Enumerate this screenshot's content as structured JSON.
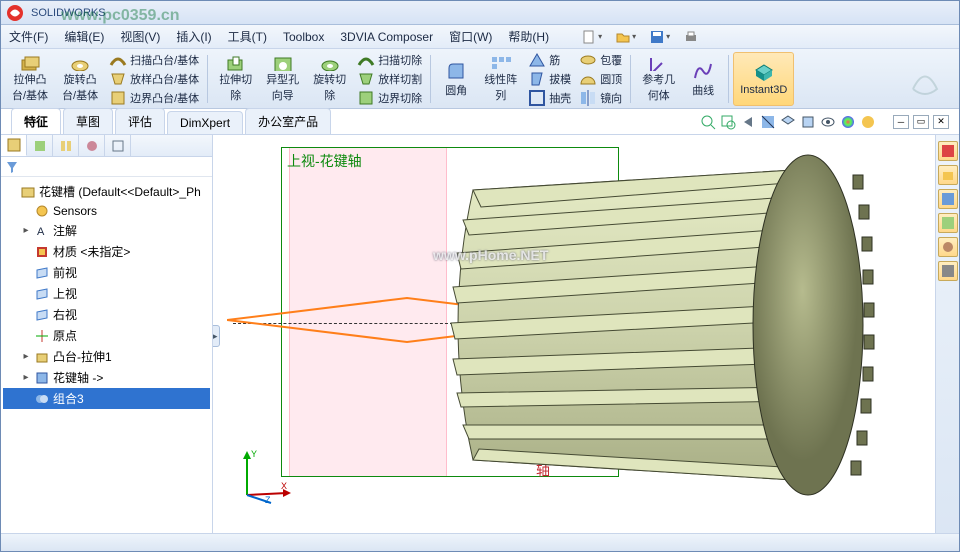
{
  "title": "SOLIDWORKS",
  "watermark": "www.pc0359.cn",
  "watermark_viewport": "www.pHome.NET",
  "menus": {
    "file": "文件(F)",
    "edit": "编辑(E)",
    "view": "视图(V)",
    "insert": "插入(I)",
    "tools": "工具(T)",
    "toolbox": "Toolbox",
    "composer": "3DVIA Composer",
    "window": "窗口(W)",
    "help": "帮助(H)"
  },
  "quick": {
    "new": "新建",
    "open": "打开",
    "save": "保存",
    "print": "打印"
  },
  "ribbon": {
    "extrude_boss": "拉伸凸\n台/基体",
    "revolve_boss": "旋转凸\n台/基体",
    "swept_boss": "扫描凸台/基体",
    "loft_boss": "放样凸台/基体",
    "boundary_boss": "边界凸台/基体",
    "extrude_cut": "拉伸切\n除",
    "hole_wizard": "异型孔\n向导",
    "revolve_cut": "旋转切\n除",
    "swept_cut": "扫描切除",
    "loft_cut": "放样切割",
    "boundary_cut": "边界切除",
    "fillet": "圆角",
    "linear_pattern": "线性阵\n列",
    "rib": "筋",
    "draft": "拔模",
    "shell": "抽壳",
    "wrap": "包覆",
    "dome": "圆顶",
    "mirror": "镜向",
    "ref_geom": "参考几\n何体",
    "curves": "曲线",
    "instant3d": "Instant3D"
  },
  "tabs": {
    "features": "特征",
    "sketch": "草图",
    "evaluate": "评估",
    "dimxpert": "DimXpert",
    "office": "办公室产品"
  },
  "tree": {
    "root": "花键槽 (Default<<Default>_Ph",
    "sensors": "Sensors",
    "annotations": "注解",
    "material": "材质 <未指定>",
    "front_plane": "前视",
    "top_plane": "上视",
    "right_plane": "右视",
    "origin": "原点",
    "boss_extrude1": "凸台-拉伸1",
    "spline_shaft": "花键轴 ->",
    "combine3": "组合3"
  },
  "viewport": {
    "top_label": "上视-花键轴",
    "side_label": "花键轴"
  },
  "colors": {
    "accent": "#2f73d0",
    "extrude_icon": "#d4b24a",
    "cut_icon": "#5a9e3e",
    "pattern_icon": "#3f79c8",
    "ref_icon": "#6a3fb8",
    "instant_icon": "#16908a",
    "part_fill": "#8e9166",
    "part_light": "#cdd3ac"
  }
}
